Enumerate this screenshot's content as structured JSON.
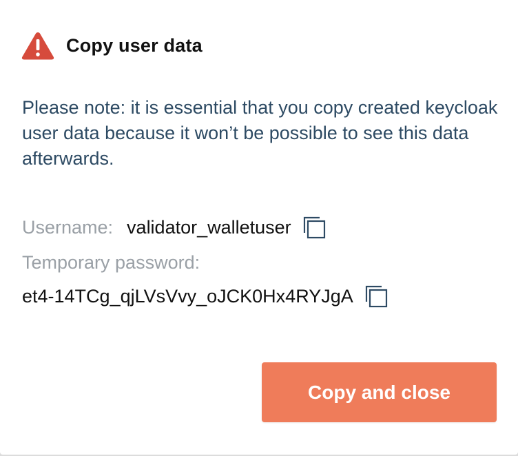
{
  "dialog": {
    "title": "Copy user data",
    "icon": "warning-triangle-icon",
    "note": "Please note: it is essential that you copy created keycloak user data because it won’t be possible to see this data afterwards.",
    "username_label": "Username:",
    "username_value": "validator_walletuser",
    "temp_password_label": "Temporary password:",
    "temp_password_value": "et4-14TCg_qjLVsVvy_oJCK0Hx4RYJgA",
    "copy_icon": "copy-icon",
    "primary_button_label": "Copy and close"
  },
  "colors": {
    "warning": "#d64b3c",
    "note_text": "#2d4a63",
    "label_text": "#9aa0a6",
    "copy_icon": "#2d4a63",
    "primary_button": "#ef7c5a"
  }
}
